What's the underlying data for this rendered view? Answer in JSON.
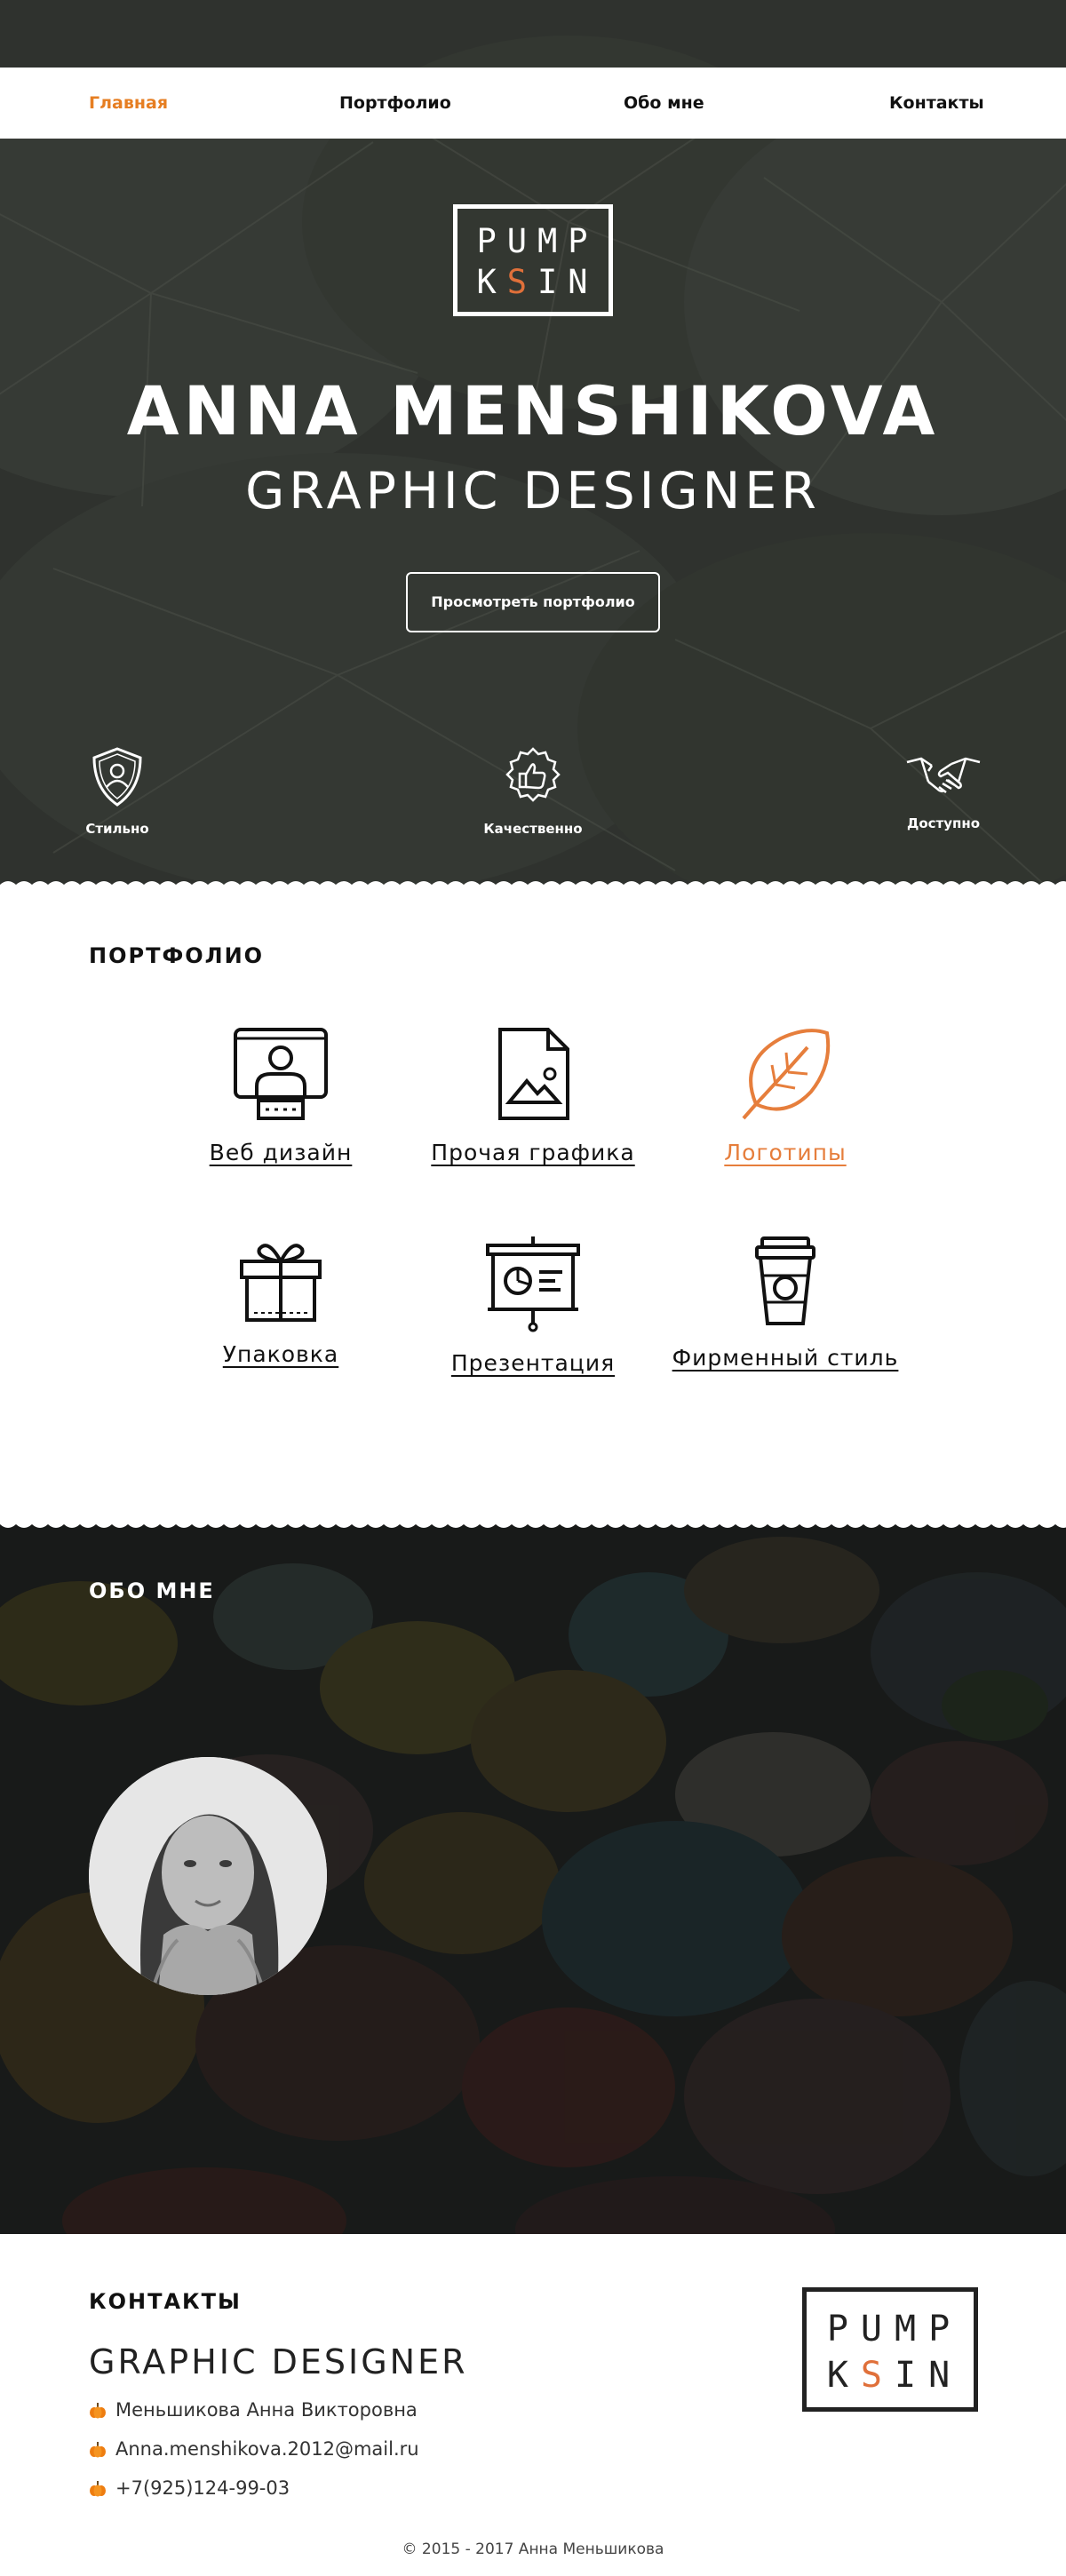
{
  "nav": {
    "items": [
      {
        "label": "Главная",
        "active": true
      },
      {
        "label": "Портфолио",
        "active": false
      },
      {
        "label": "Обо мне",
        "active": false
      },
      {
        "label": "Контакты",
        "active": false
      }
    ]
  },
  "logo": {
    "line1": "PUMP",
    "line2_left": "K",
    "line2_mark": "S",
    "line2_right": "IN"
  },
  "hero": {
    "name": "ANNA MENSHIKOVA",
    "role": "GRAPHIC DESIGNER",
    "button_label": "Просмотреть портфолио",
    "features": [
      {
        "label": "Стильно",
        "icon": "shield-user-icon"
      },
      {
        "label": "Качественно",
        "icon": "thumbs-up-badge-icon"
      },
      {
        "label": "Доступно",
        "icon": "handshake-icon"
      }
    ]
  },
  "portfolio": {
    "title": "ПОРТФОЛИО",
    "items": [
      {
        "label": "Веб дизайн",
        "icon": "monitor-user-icon"
      },
      {
        "label": "Прочая графика",
        "icon": "image-file-icon"
      },
      {
        "label": "Логотипы",
        "icon": "leaf-icon"
      },
      {
        "label": "Упаковка",
        "icon": "gift-box-icon"
      },
      {
        "label": "Презентация",
        "icon": "presentation-board-icon"
      },
      {
        "label": "Фирменный стиль",
        "icon": "coffee-cup-icon"
      }
    ]
  },
  "about": {
    "title": "ОБО МНЕ"
  },
  "contacts": {
    "title": "КОНТАКТЫ",
    "role": "GRAPHIC DESIGNER",
    "name": "Меньшикова Анна Викторовна",
    "email": "Anna.menshikova.2012@mail.ru",
    "phone": "+7(925)124-99-03"
  },
  "footer": {
    "copyright": "© 2015 - 2017 Анна Меньшикова"
  },
  "colors": {
    "accent": "#e67e22",
    "hero_bg": "#2f322e",
    "about_bg": "#2a2c2b",
    "text": "#111111"
  }
}
